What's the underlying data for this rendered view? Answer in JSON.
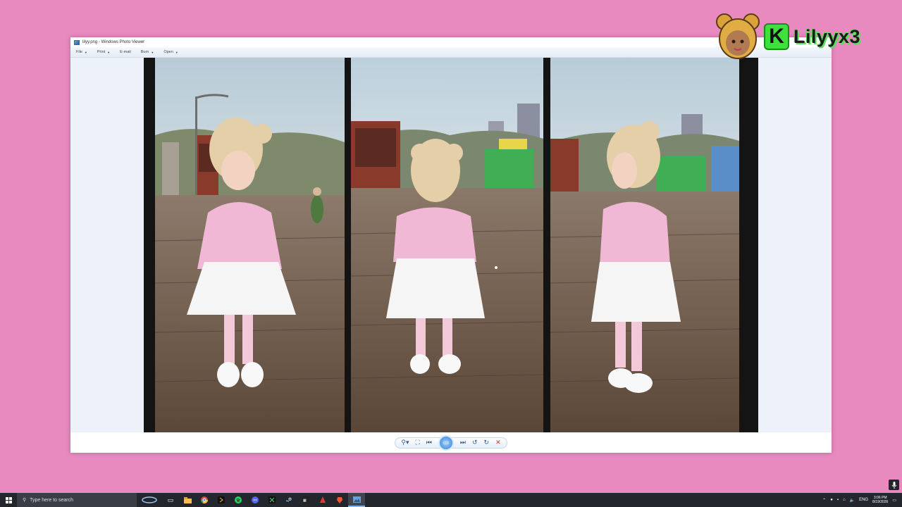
{
  "window": {
    "title": "lilyy.png - Windows Photo Viewer",
    "menu": [
      {
        "label": "File",
        "has_dropdown": true
      },
      {
        "label": "Print",
        "has_dropdown": true
      },
      {
        "label": "E-mail",
        "has_dropdown": false
      },
      {
        "label": "Burn",
        "has_dropdown": true
      },
      {
        "label": "Open",
        "has_dropdown": true
      }
    ]
  },
  "image": {
    "description_icons": [
      "front-view",
      "back-view",
      "side-view"
    ]
  },
  "controls": {
    "zoom_icon": "magnifier-icon",
    "actual_size_icon": "fit-icon",
    "previous_icon": "previous-icon",
    "slideshow_icon": "slideshow-icon",
    "next_icon": "next-icon",
    "rotate_ccw_icon": "rotate-counterclockwise-icon",
    "rotate_cw_icon": "rotate-clockwise-icon",
    "delete_icon": "delete-icon"
  },
  "overlay": {
    "brand_letter": "K",
    "name": "Lilyyx3"
  },
  "taskbar": {
    "search_placeholder": "Type here to search",
    "tray": {
      "language": "ENG",
      "time": "3:06 PM",
      "date": "8/19/2026"
    }
  },
  "colors": {
    "background": "#e88ac0",
    "taskbar": "#23262d",
    "brand_green": "#3ee03e"
  }
}
